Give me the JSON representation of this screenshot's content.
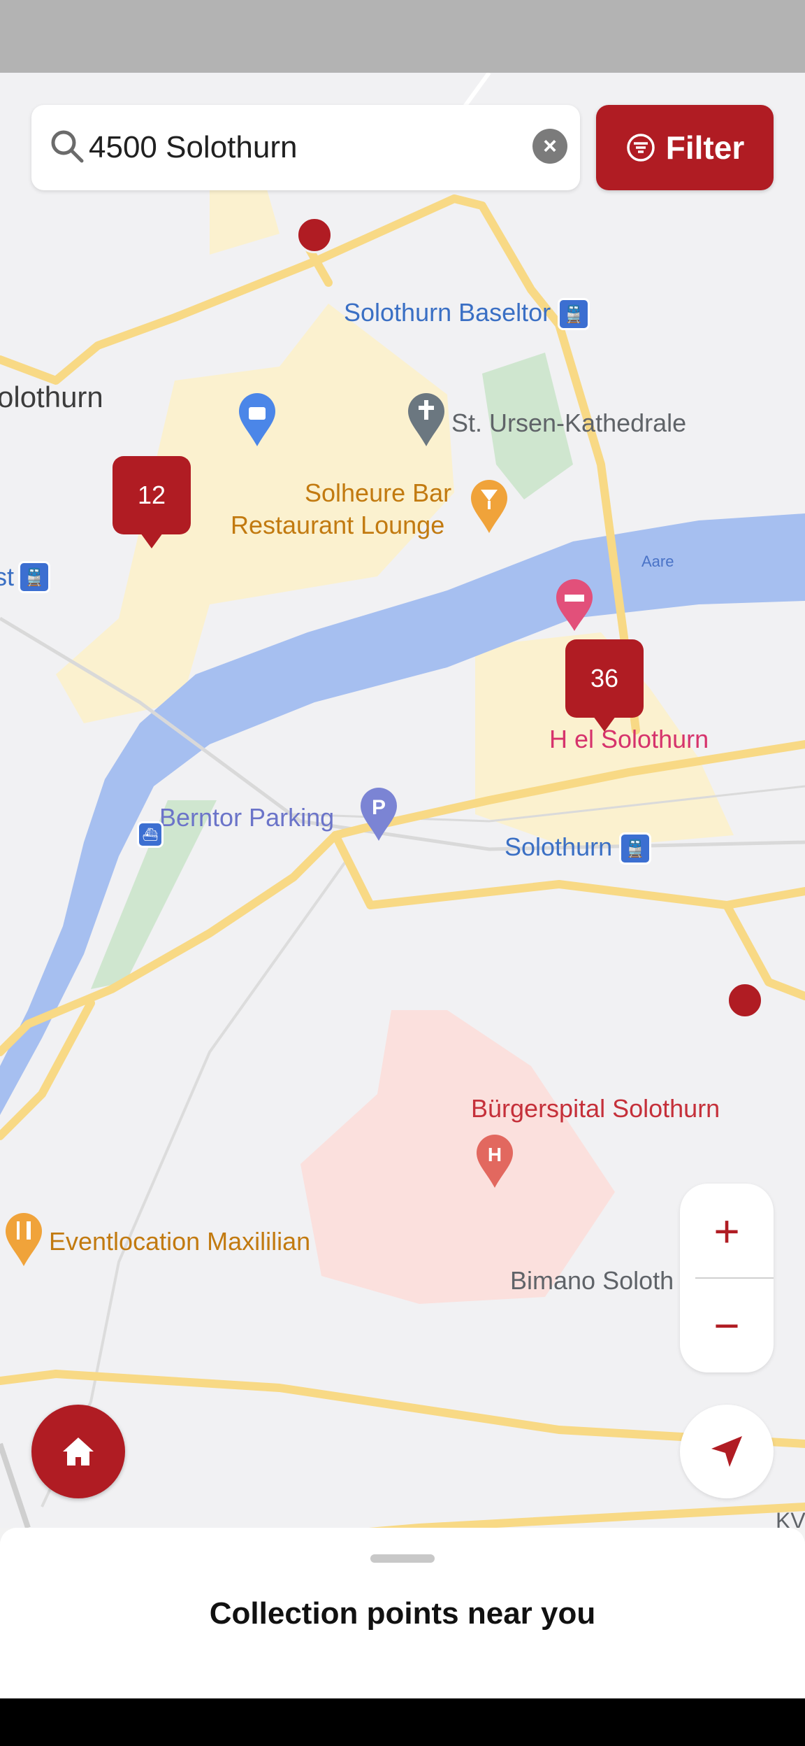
{
  "search": {
    "value": "4500 Solothurn",
    "icon": "search-icon",
    "clear_icon": "clear-icon"
  },
  "filter": {
    "label": "Filter",
    "icon": "filter-icon"
  },
  "map": {
    "labels": {
      "baseltor": "Solothurn Baseltor",
      "kathedrale": "St. Ursen-Kathedrale",
      "solothurn_left": "olothurn",
      "bar_line1": "Solheure Bar",
      "bar_line2": "Restaurant Lounge",
      "aare": "Aare",
      "hotel": "H    el Solothurn",
      "berntor": "Berntor Parking",
      "station": "Solothurn",
      "st": "st",
      "spital": "Bürgerspital Solothurn",
      "eventlocation": "Eventlocation Maxililian",
      "bimano": "Bimano Soloth",
      "kv": "KV"
    },
    "clusters": {
      "west": "12",
      "east": "36"
    }
  },
  "controls": {
    "zoom_in": "+",
    "zoom_out": "−"
  },
  "sheet": {
    "title": "Collection points near you"
  },
  "colors": {
    "brand": "#b01c23",
    "road": "#f8d985",
    "water": "#a6bff0",
    "park": "#cfe6cf",
    "built": "#fbf1cf"
  }
}
